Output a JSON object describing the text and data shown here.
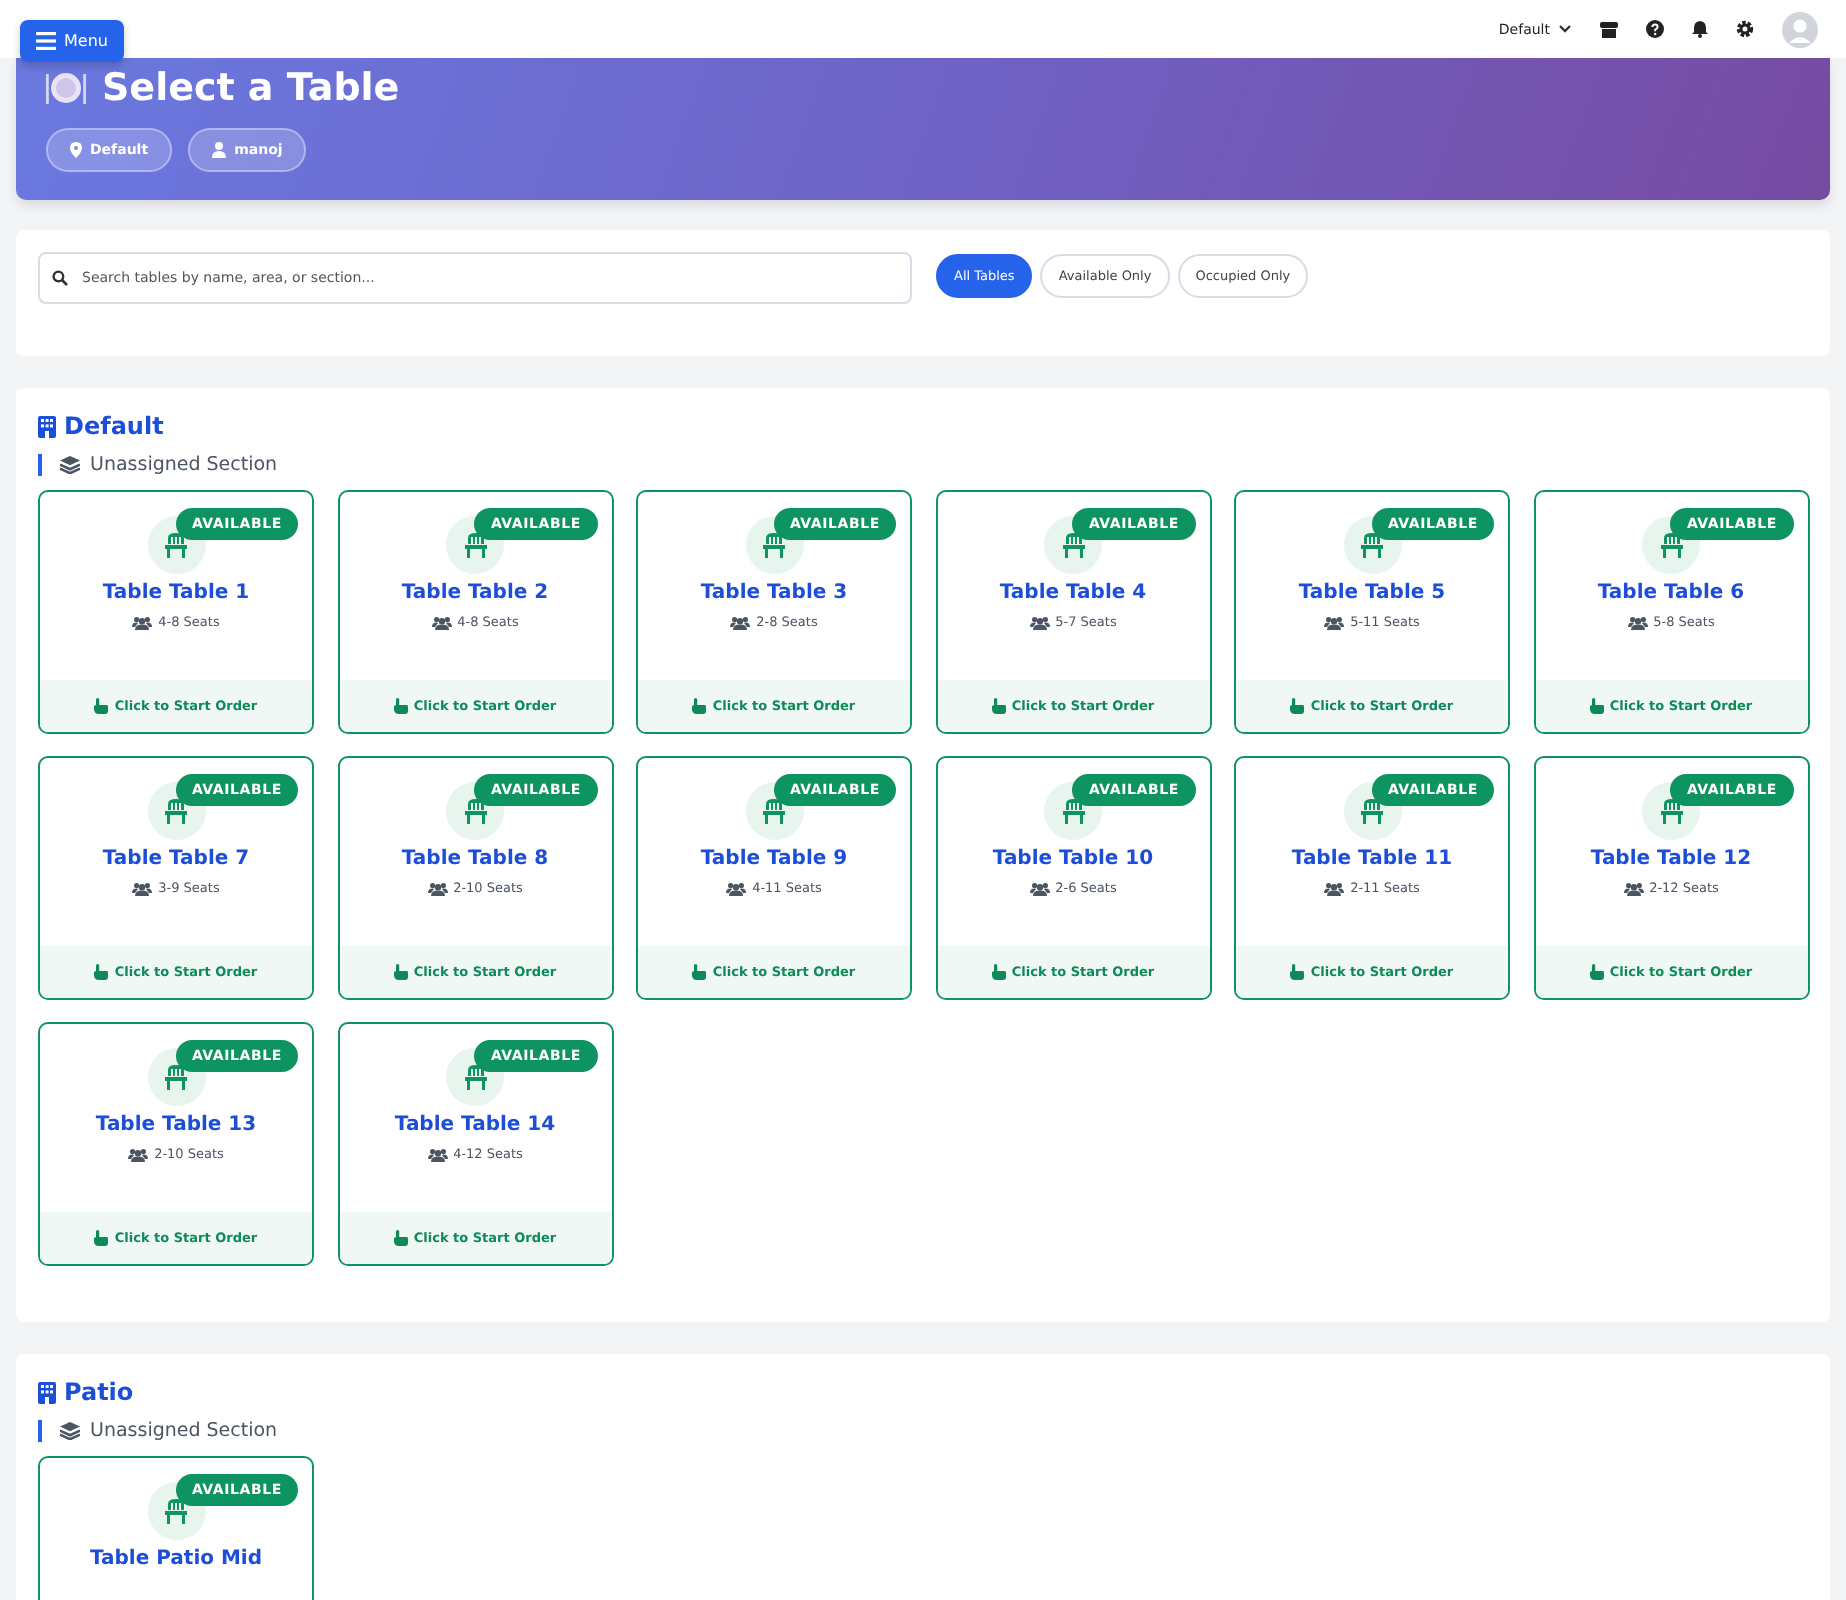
{
  "menu_button": {
    "label": "Menu"
  },
  "top_bar": {
    "location_select": "Default"
  },
  "header": {
    "title": "Select a Table",
    "chips": [
      {
        "kind": "location",
        "label": "Default"
      },
      {
        "kind": "user",
        "label": "manoj"
      }
    ]
  },
  "search": {
    "placeholder": "Search tables by name, area, or section..."
  },
  "filters": [
    {
      "label": "All Tables",
      "selected": true
    },
    {
      "label": "Available Only",
      "selected": false
    },
    {
      "label": "Occupied Only",
      "selected": false
    }
  ],
  "areas": [
    {
      "name": "Default",
      "section": "Unassigned Section",
      "tables": [
        {
          "name": "Table Table 1",
          "seats": "4-8 Seats",
          "kind": "available",
          "badge": "AVAILABLE",
          "action": "Click to Start Order"
        },
        {
          "name": "Table Table 2",
          "seats": "4-8 Seats",
          "kind": "available",
          "badge": "AVAILABLE",
          "action": "Click to Start Order"
        },
        {
          "name": "Table Table 3",
          "seats": "2-8 Seats",
          "kind": "available",
          "badge": "AVAILABLE",
          "action": "Click to Start Order"
        },
        {
          "name": "Table Table 4",
          "seats": "5-7 Seats",
          "kind": "available",
          "badge": "AVAILABLE",
          "action": "Click to Start Order"
        },
        {
          "name": "Table Table 5",
          "seats": "5-11 Seats",
          "kind": "available",
          "badge": "AVAILABLE",
          "action": "Click to Start Order"
        },
        {
          "name": "Table Table 6",
          "seats": "5-8 Seats",
          "kind": "available",
          "badge": "AVAILABLE",
          "action": "Click to Start Order"
        },
        {
          "name": "Table Table 7",
          "seats": "3-9 Seats",
          "kind": "available",
          "badge": "AVAILABLE",
          "action": "Click to Start Order"
        },
        {
          "name": "Table Table 8",
          "seats": "2-10 Seats",
          "kind": "available",
          "badge": "AVAILABLE",
          "action": "Click to Start Order"
        },
        {
          "name": "Table Table 9",
          "seats": "4-11 Seats",
          "kind": "available",
          "badge": "AVAILABLE",
          "action": "Click to Start Order"
        },
        {
          "name": "Table Table 10",
          "seats": "2-6 Seats",
          "kind": "available",
          "badge": "AVAILABLE",
          "action": "Click to Start Order"
        },
        {
          "name": "Table Table 11",
          "seats": "2-11 Seats",
          "kind": "available",
          "badge": "AVAILABLE",
          "action": "Click to Start Order"
        },
        {
          "name": "Table Table 12",
          "seats": "2-12 Seats",
          "kind": "available",
          "badge": "AVAILABLE",
          "action": "Click to Start Order"
        },
        {
          "name": "Table Table 13",
          "seats": "2-10 Seats",
          "kind": "available",
          "badge": "AVAILABLE",
          "action": "Click to Start Order"
        },
        {
          "name": "Table Table 14",
          "seats": "4-12 Seats",
          "kind": "available",
          "badge": "AVAILABLE",
          "action": "Click to Start Order"
        }
      ]
    },
    {
      "name": "Patio",
      "section": "Unassigned Section",
      "tables": [
        {
          "name": "Table Patio Mid",
          "kind": "available",
          "badge": "AVAILABLE"
        }
      ]
    }
  ]
}
